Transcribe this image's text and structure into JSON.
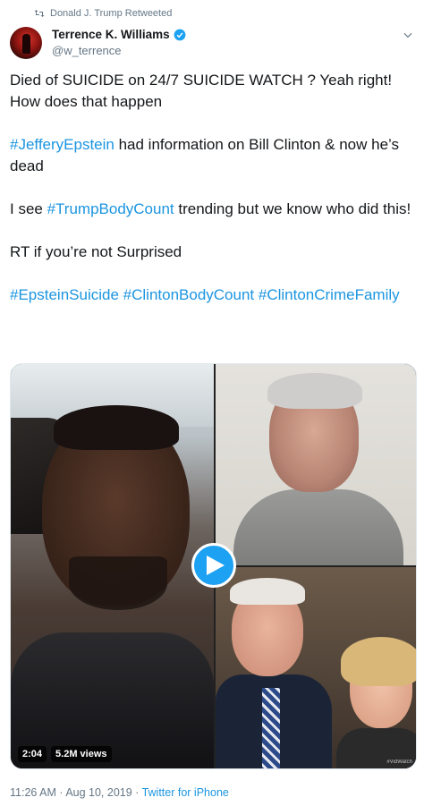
{
  "retweet": {
    "label": "Donald J. Trump Retweeted",
    "icon": "retweet-icon"
  },
  "author": {
    "display_name": "Terrence K. Williams",
    "handle": "@w_terrence",
    "verified_icon": "verified-badge-icon"
  },
  "tweet": {
    "paragraphs": [
      {
        "segments": [
          {
            "text": "Died of SUICIDE on 24/7 SUICIDE WATCH ? Yeah right! How does that happen",
            "hashtag": false
          }
        ]
      },
      {
        "segments": [
          {
            "text": "#JefferyEpstein",
            "hashtag": true
          },
          {
            "text": " had information on Bill Clinton & now he’s dead",
            "hashtag": false
          }
        ]
      },
      {
        "segments": [
          {
            "text": "I see ",
            "hashtag": false
          },
          {
            "text": "#TrumpBodyCount",
            "hashtag": true
          },
          {
            "text": " trending but we know who did this!",
            "hashtag": false
          }
        ]
      },
      {
        "segments": [
          {
            "text": "RT if you’re not Surprised",
            "hashtag": false
          }
        ]
      },
      {
        "segments": [
          {
            "text": "#EpsteinSuicide",
            "hashtag": true
          },
          {
            "text": " ",
            "hashtag": false
          },
          {
            "text": "#ClintonBodyCount",
            "hashtag": true
          },
          {
            "text": " ",
            "hashtag": false
          },
          {
            "text": "#ClintonCrimeFamily",
            "hashtag": true
          }
        ]
      }
    ]
  },
  "media": {
    "duration": "2:04",
    "views": "5.2M views",
    "watermark": "#VidWatch"
  },
  "footer": {
    "time": "11:26 AM",
    "separator": " · ",
    "date": "Aug 10, 2019",
    "source": "Twitter for iPhone"
  },
  "colors": {
    "link": "#1b95e0",
    "secondary_text": "#657786",
    "play_button": "#1da1f2"
  }
}
